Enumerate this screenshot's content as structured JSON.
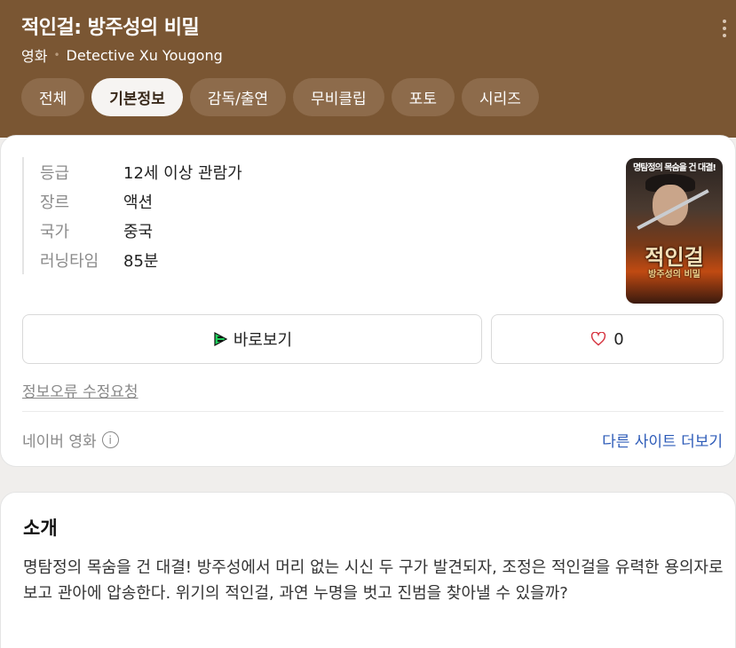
{
  "header": {
    "title": "적인걸: 방주성의 비밀",
    "category": "영화",
    "english_title": "Detective Xu Yougong",
    "more_icon": "more-vertical-icon"
  },
  "tabs": [
    {
      "label": "전체",
      "active": false
    },
    {
      "label": "기본정보",
      "active": true
    },
    {
      "label": "감독/출연",
      "active": false
    },
    {
      "label": "무비클립",
      "active": false
    },
    {
      "label": "포토",
      "active": false
    },
    {
      "label": "시리즈",
      "active": false
    }
  ],
  "info": [
    {
      "key": "등급",
      "value": "12세 이상 관람가"
    },
    {
      "key": "장르",
      "value": "액션"
    },
    {
      "key": "국가",
      "value": "중국"
    },
    {
      "key": "러닝타임",
      "value": "85분"
    }
  ],
  "poster": {
    "tagline": "명탐정의 목숨을 건 대결!",
    "title": "적인걸",
    "subtitle": "방주성의 비밀"
  },
  "actions": {
    "watch_label": "바로보기",
    "watch_icon": "play-icon",
    "like_count": "0",
    "like_icon": "heart-icon"
  },
  "report_label": "정보오류 수정요청",
  "source": {
    "label": "네이버 영화",
    "info_icon": "i",
    "other_sites": "다른 사이트 더보기"
  },
  "intro": {
    "title": "소개",
    "text": "명탐정의 목숨을 건 대결! 방주성에서 머리 없는 시신 두 구가 발견되자, 조정은 적인걸을 유력한 용의자로 보고 관아에 압송한다. 위기의 적인걸, 과연 누명을 벗고 진범을 찾아낼 수 있을까?"
  },
  "colors": {
    "header_bg": "#7a5633",
    "tab_bg": "#8d6b4b",
    "tab_active_bg": "#f6f4f2",
    "link": "#2d5bb8",
    "watch_icon_green": "#1fcf5c",
    "heart": "#d6333f"
  }
}
